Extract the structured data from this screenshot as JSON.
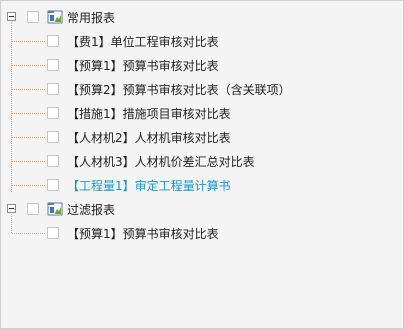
{
  "tree": {
    "groups": [
      {
        "label": "常用报表",
        "items": [
          {
            "label": "【费1】单位工程审核对比表",
            "selected": false
          },
          {
            "label": "【预算1】预算书审核对比表",
            "selected": false
          },
          {
            "label": "【预算2】预算书审核对比表（含关联项）",
            "selected": false
          },
          {
            "label": "【措施1】措施项目审核对比表",
            "selected": false
          },
          {
            "label": "【人材机2】人材机审核对比表",
            "selected": false
          },
          {
            "label": "【人材机3】人材机价差汇总对比表",
            "selected": false
          },
          {
            "label": "【工程量1】审定工程量计算书",
            "selected": true
          }
        ]
      },
      {
        "label": "过滤报表",
        "items": [
          {
            "label": "【预算1】预算书审核对比表",
            "selected": false
          }
        ]
      }
    ]
  },
  "colors": {
    "selected_text": "#1a96d4",
    "tree_line": "#f0a66a",
    "panel_bg": "#f4f4f4"
  },
  "icons": {
    "expander": "minus-expander-icon",
    "group": "report-folder-icon"
  }
}
